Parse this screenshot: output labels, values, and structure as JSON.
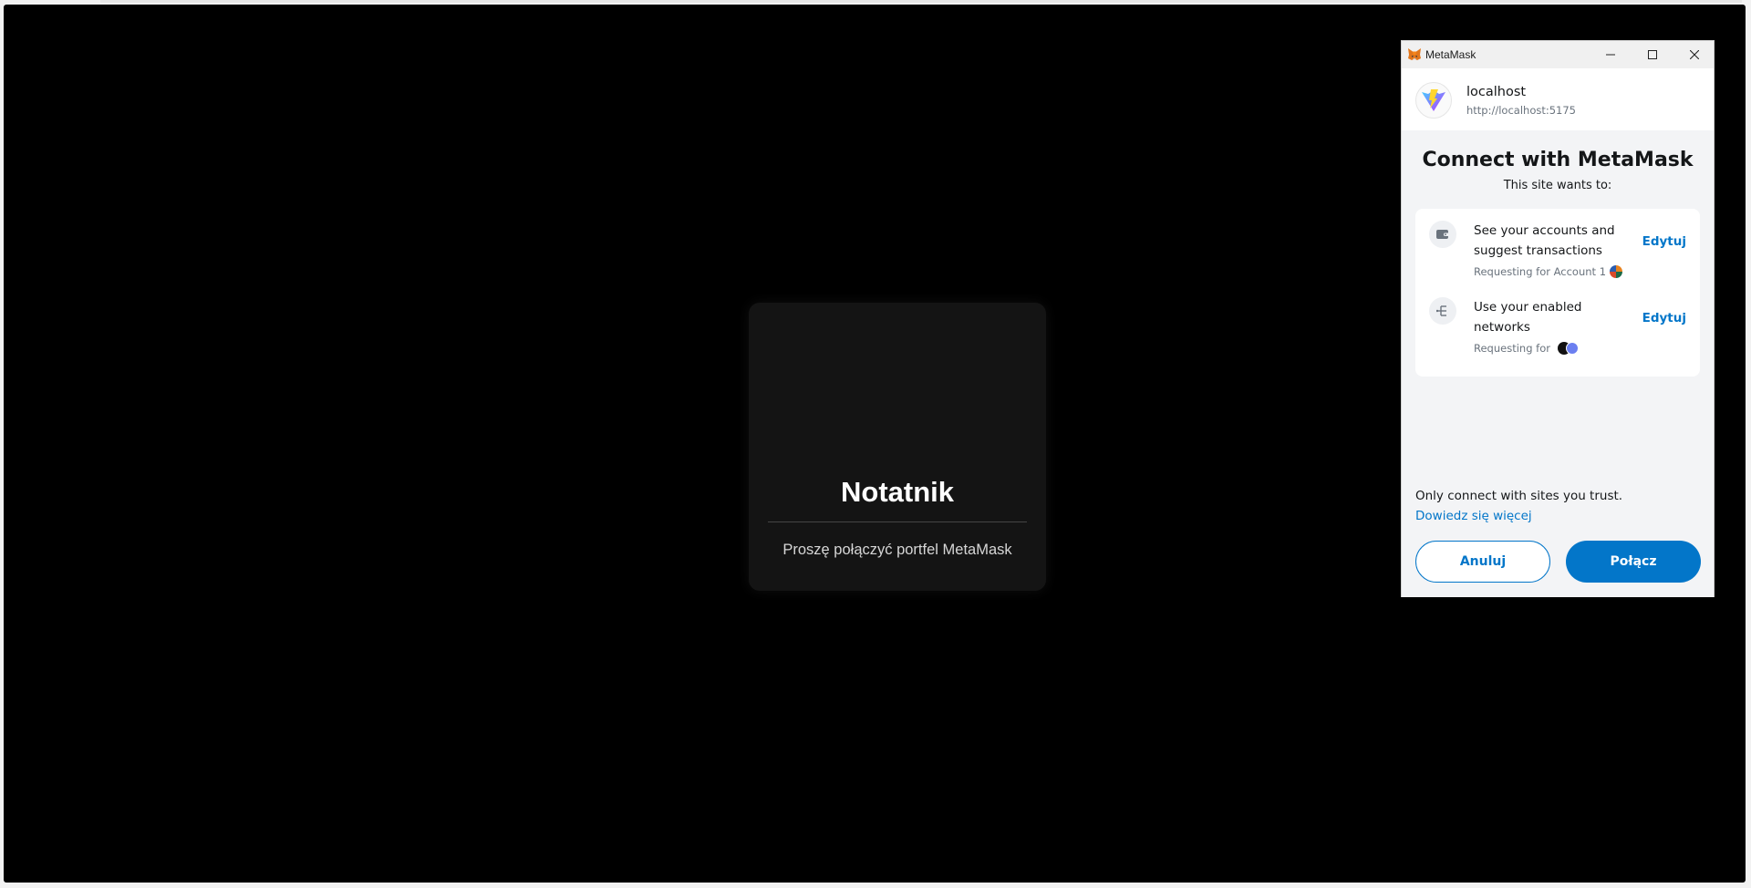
{
  "app": {
    "title": "Notatnik",
    "message": "Proszę połączyć portfel MetaMask"
  },
  "metamask": {
    "window_title": "MetaMask",
    "site": {
      "name": "localhost",
      "url": "http://localhost:5175"
    },
    "heading": "Connect with MetaMask",
    "subheading": "This site wants to:",
    "permissions": [
      {
        "icon": "wallet-icon",
        "title": "See your accounts and suggest transactions",
        "requesting": "Requesting for Account 1",
        "edit_label": "Edytuj"
      },
      {
        "icon": "network-icon",
        "title": "Use your enabled networks",
        "requesting": "Requesting for",
        "edit_label": "Edytuj"
      }
    ],
    "trust_notice": "Only connect with sites you trust.",
    "learn_more": "Dowiedz się więcej",
    "cancel_label": "Anuluj",
    "connect_label": "Połącz"
  },
  "colors": {
    "accent": "#0376c9",
    "app_background": "#000000",
    "card_background": "#141414"
  }
}
